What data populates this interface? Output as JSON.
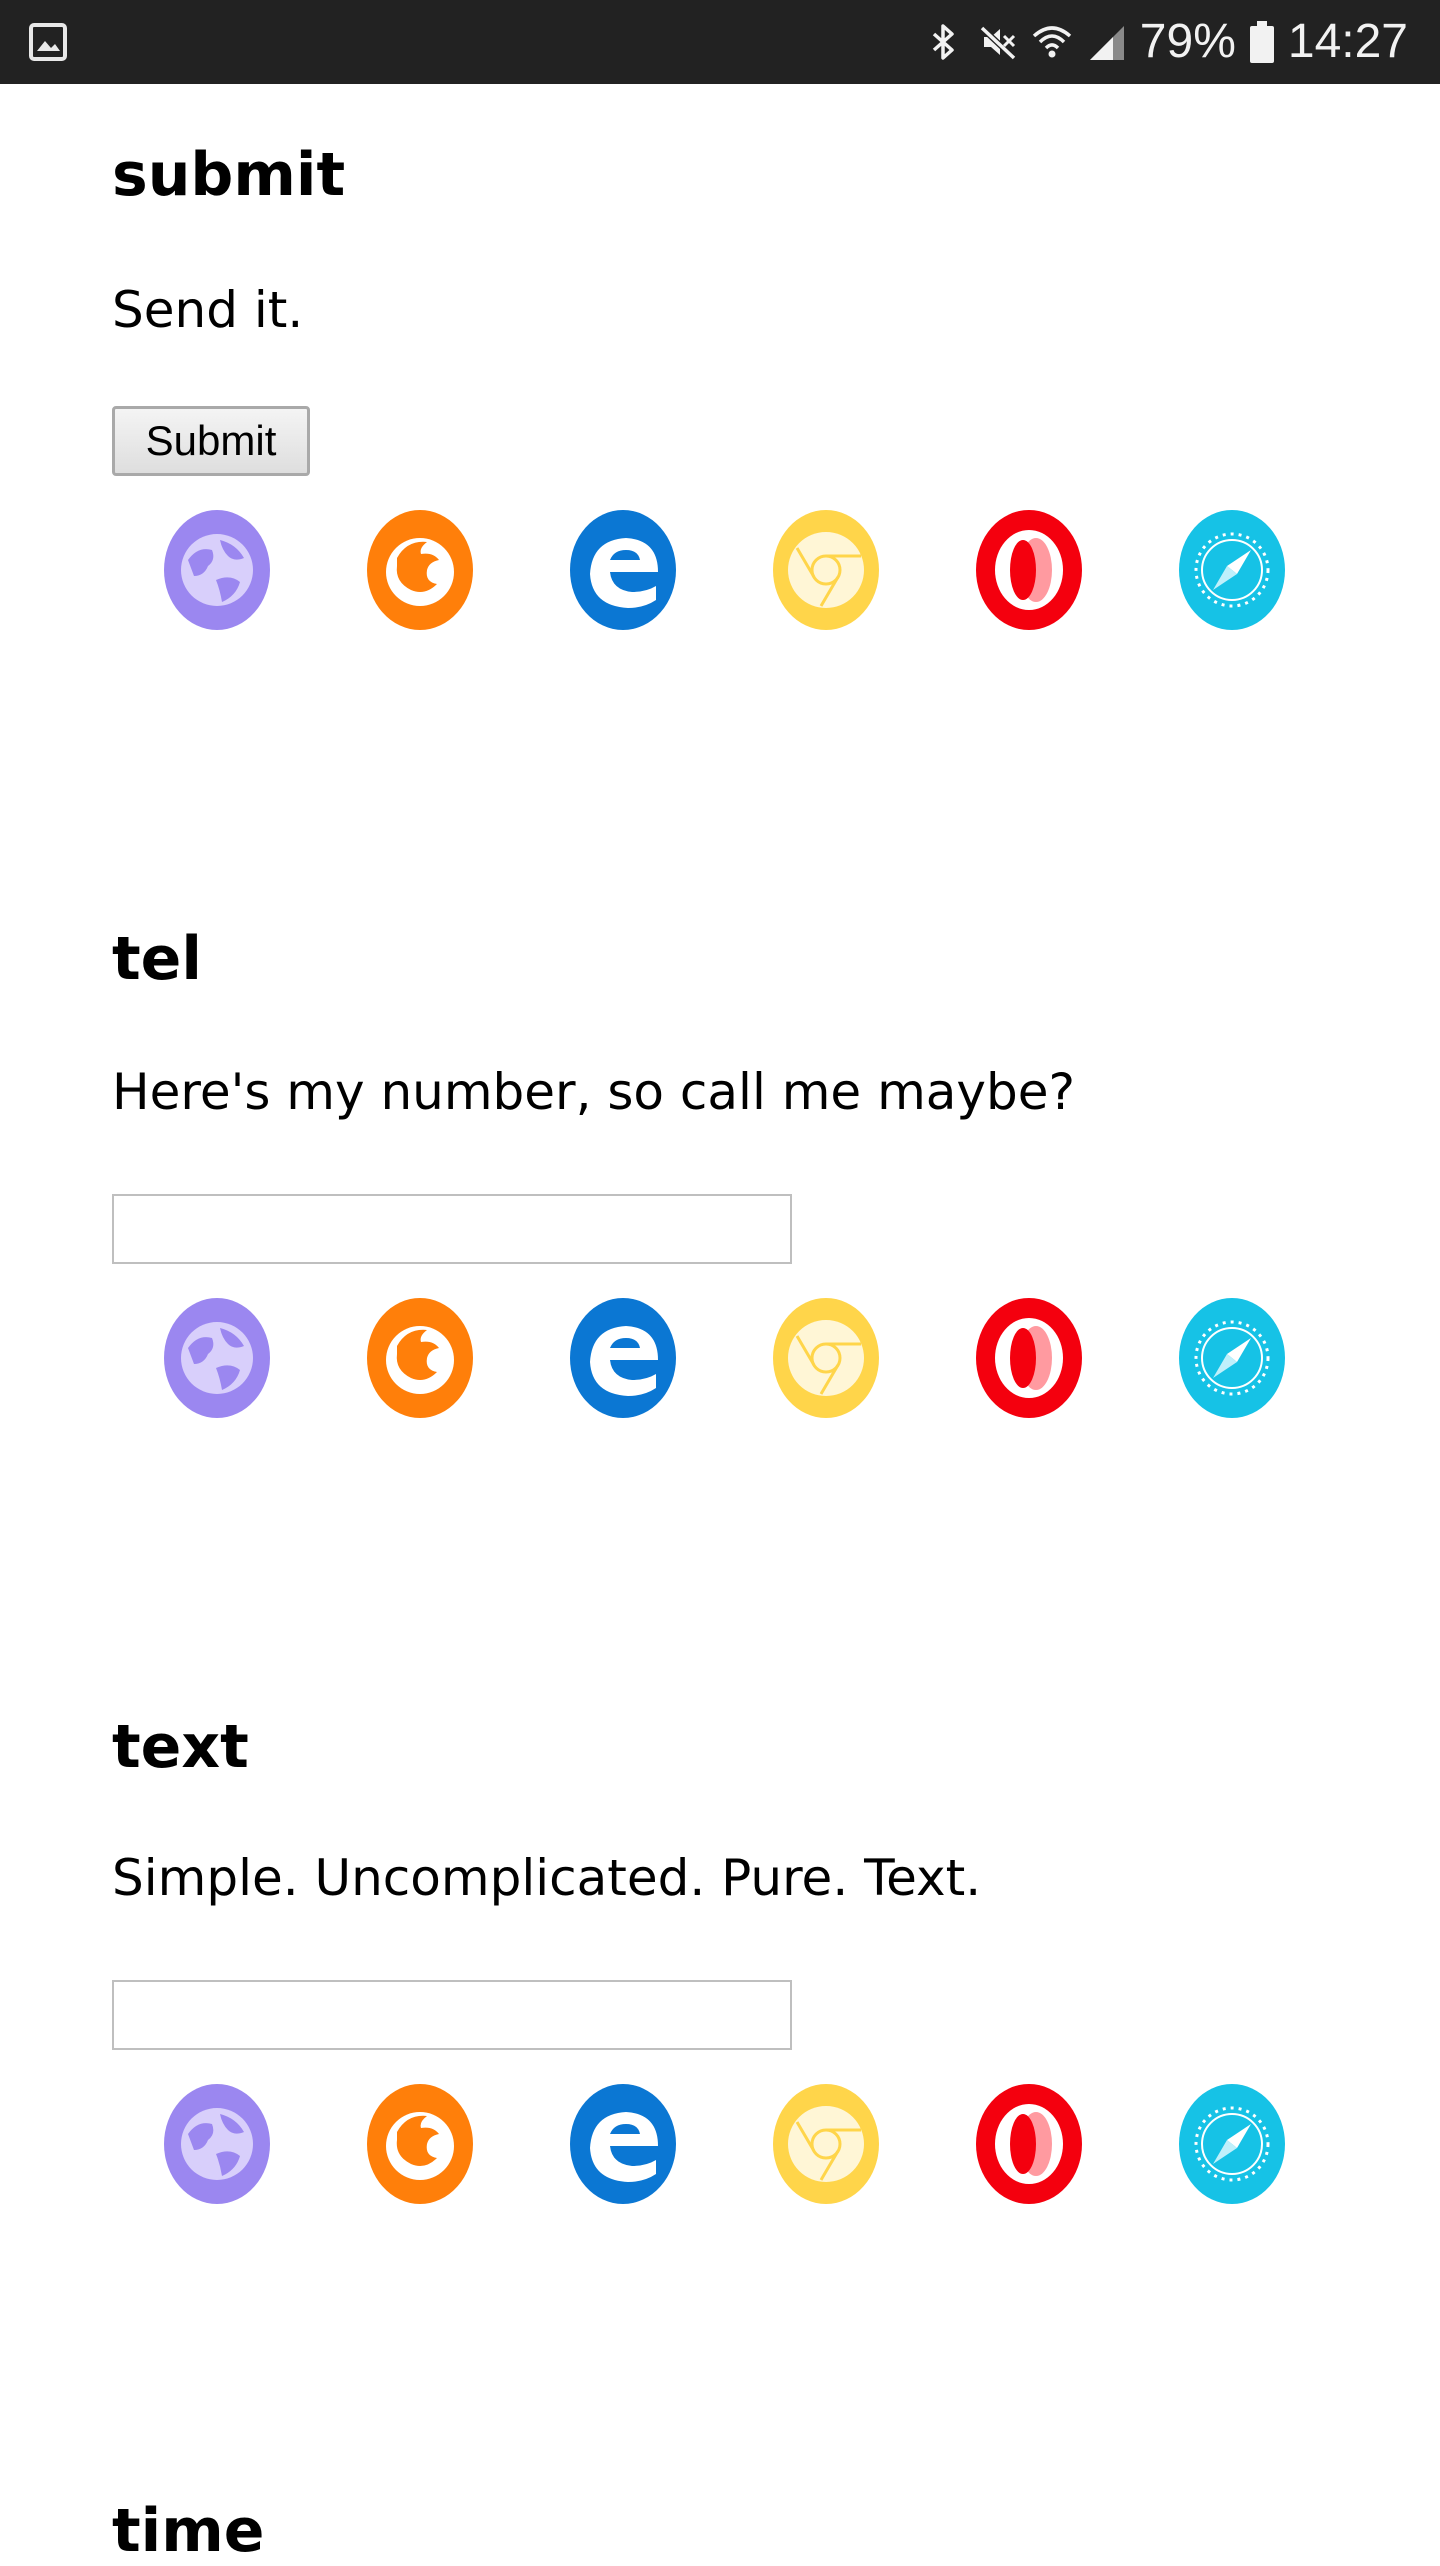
{
  "status_bar": {
    "battery_percent": "79%",
    "time": "14:27",
    "icons": [
      "image-notification-icon",
      "bluetooth-icon",
      "mute-icon",
      "wifi-icon",
      "signal-icon",
      "battery-icon"
    ]
  },
  "sections": [
    {
      "title": "submit",
      "description": "Send it.",
      "control": "button",
      "button_label": "Submit"
    },
    {
      "title": "tel",
      "description": "Here's my number, so call me maybe?",
      "control": "input",
      "value": ""
    },
    {
      "title": "text",
      "description": "Simple. Uncomplicated. Pure. Text.",
      "control": "input",
      "value": ""
    },
    {
      "title": "time"
    }
  ],
  "browser_icons": [
    {
      "name": "samsung-internet-icon",
      "color": "#9b87f0"
    },
    {
      "name": "firefox-icon",
      "color": "#ff7f0a"
    },
    {
      "name": "edge-icon",
      "color": "#0b77d3"
    },
    {
      "name": "chrome-icon",
      "color": "#ffd54a"
    },
    {
      "name": "opera-icon",
      "color": "#f4000e"
    },
    {
      "name": "safari-icon",
      "color": "#16c2e6"
    }
  ]
}
